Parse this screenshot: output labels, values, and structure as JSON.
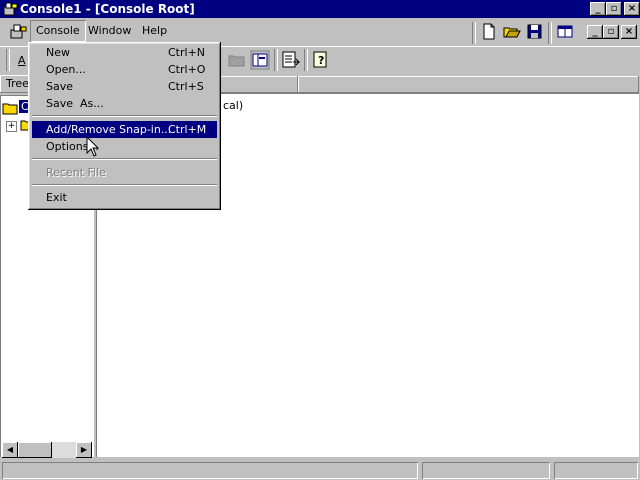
{
  "window": {
    "title": "Console1 - [Console Root]",
    "controls": {
      "minimize": "_",
      "restore": "▫",
      "close": "×"
    }
  },
  "menubar": {
    "items": [
      {
        "label": "Console"
      },
      {
        "label": "Window"
      },
      {
        "label": "Help"
      }
    ],
    "action_partial": "A"
  },
  "tree_pane": {
    "header": "Tree",
    "root_partial": "C"
  },
  "list_pane": {
    "partial_item": "cal)"
  },
  "console_menu": {
    "items": [
      {
        "label": "New",
        "shortcut": "Ctrl+N"
      },
      {
        "label": "Open...",
        "shortcut": "Ctrl+O"
      },
      {
        "label": "Save",
        "shortcut": "Ctrl+S"
      },
      {
        "label": "Save  As...",
        "shortcut": ""
      },
      {
        "label": "Add/Remove Snap-in...",
        "shortcut": "Ctrl+M"
      },
      {
        "label": "Options...",
        "shortcut": ""
      },
      {
        "label": "Recent File",
        "shortcut": ""
      },
      {
        "label": "Exit",
        "shortcut": ""
      }
    ]
  },
  "colors": {
    "title_bar": "#000080",
    "highlight": "#000080",
    "face": "#c0c0c0"
  }
}
